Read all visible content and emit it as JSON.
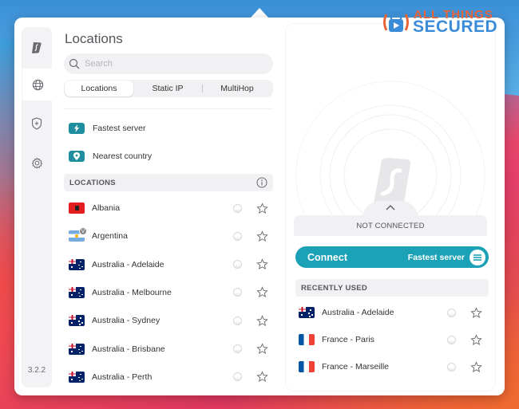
{
  "app": {
    "title": "Locations",
    "version": "3.2.2"
  },
  "watermark": {
    "line1": "ALL THINGS",
    "line2": "SECURED"
  },
  "sidebar": {
    "items": [
      {
        "name": "surfshark-home",
        "icon": "surfshark-logo-icon"
      },
      {
        "name": "locations",
        "icon": "globe-icon",
        "active": true
      },
      {
        "name": "one",
        "icon": "shield-plus-icon"
      },
      {
        "name": "settings",
        "icon": "gear-icon"
      }
    ]
  },
  "search": {
    "placeholder": "Search",
    "value": ""
  },
  "tabs": [
    {
      "label": "Locations",
      "active": true
    },
    {
      "label": "Static IP",
      "active": false
    },
    {
      "label": "MultiHop",
      "active": false
    }
  ],
  "quick_connect": [
    {
      "label": "Fastest server",
      "icon": "lightning-icon"
    },
    {
      "label": "Nearest country",
      "icon": "pin-icon"
    }
  ],
  "locations_section": {
    "header": "LOCATIONS",
    "info_icon": "info-icon",
    "items": [
      {
        "name": "Albania",
        "flag": "albania"
      },
      {
        "name": "Argentina",
        "flag": "argentina",
        "badge": "V"
      },
      {
        "name": "Australia - Adelaide",
        "flag": "australia"
      },
      {
        "name": "Australia - Melbourne",
        "flag": "australia"
      },
      {
        "name": "Australia - Sydney",
        "flag": "australia"
      },
      {
        "name": "Australia - Brisbane",
        "flag": "australia"
      },
      {
        "name": "Australia - Perth",
        "flag": "australia"
      }
    ]
  },
  "connection": {
    "status": "NOT CONNECTED",
    "connect_label": "Connect",
    "server_label": "Fastest server"
  },
  "recent": {
    "header": "RECENTLY USED",
    "items": [
      {
        "name": "Australia - Adelaide",
        "flag": "australia"
      },
      {
        "name": "France - Paris",
        "flag": "france"
      },
      {
        "name": "France - Marseille",
        "flag": "france"
      }
    ]
  },
  "colors": {
    "accent": "#1ba2b7",
    "quick_icon": "#1f8e9e"
  }
}
